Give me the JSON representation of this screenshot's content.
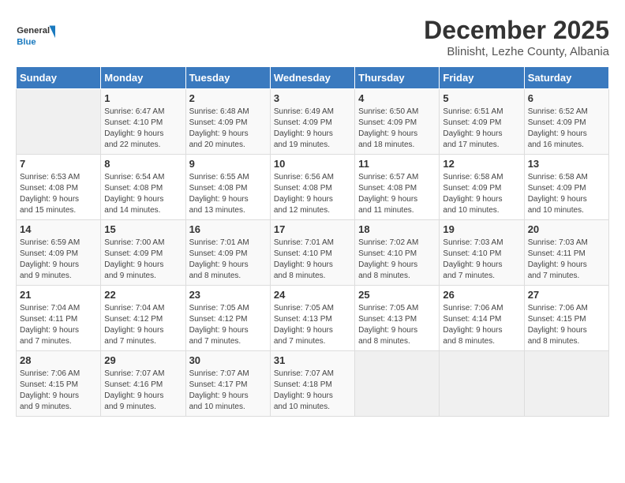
{
  "header": {
    "logo_general": "General",
    "logo_blue": "Blue",
    "month_title": "December 2025",
    "subtitle": "Blinisht, Lezhe County, Albania"
  },
  "weekdays": [
    "Sunday",
    "Monday",
    "Tuesday",
    "Wednesday",
    "Thursday",
    "Friday",
    "Saturday"
  ],
  "weeks": [
    [
      {
        "day": "",
        "info": ""
      },
      {
        "day": "1",
        "info": "Sunrise: 6:47 AM\nSunset: 4:10 PM\nDaylight: 9 hours\nand 22 minutes."
      },
      {
        "day": "2",
        "info": "Sunrise: 6:48 AM\nSunset: 4:09 PM\nDaylight: 9 hours\nand 20 minutes."
      },
      {
        "day": "3",
        "info": "Sunrise: 6:49 AM\nSunset: 4:09 PM\nDaylight: 9 hours\nand 19 minutes."
      },
      {
        "day": "4",
        "info": "Sunrise: 6:50 AM\nSunset: 4:09 PM\nDaylight: 9 hours\nand 18 minutes."
      },
      {
        "day": "5",
        "info": "Sunrise: 6:51 AM\nSunset: 4:09 PM\nDaylight: 9 hours\nand 17 minutes."
      },
      {
        "day": "6",
        "info": "Sunrise: 6:52 AM\nSunset: 4:09 PM\nDaylight: 9 hours\nand 16 minutes."
      }
    ],
    [
      {
        "day": "7",
        "info": "Sunrise: 6:53 AM\nSunset: 4:08 PM\nDaylight: 9 hours\nand 15 minutes."
      },
      {
        "day": "8",
        "info": "Sunrise: 6:54 AM\nSunset: 4:08 PM\nDaylight: 9 hours\nand 14 minutes."
      },
      {
        "day": "9",
        "info": "Sunrise: 6:55 AM\nSunset: 4:08 PM\nDaylight: 9 hours\nand 13 minutes."
      },
      {
        "day": "10",
        "info": "Sunrise: 6:56 AM\nSunset: 4:08 PM\nDaylight: 9 hours\nand 12 minutes."
      },
      {
        "day": "11",
        "info": "Sunrise: 6:57 AM\nSunset: 4:08 PM\nDaylight: 9 hours\nand 11 minutes."
      },
      {
        "day": "12",
        "info": "Sunrise: 6:58 AM\nSunset: 4:09 PM\nDaylight: 9 hours\nand 10 minutes."
      },
      {
        "day": "13",
        "info": "Sunrise: 6:58 AM\nSunset: 4:09 PM\nDaylight: 9 hours\nand 10 minutes."
      }
    ],
    [
      {
        "day": "14",
        "info": "Sunrise: 6:59 AM\nSunset: 4:09 PM\nDaylight: 9 hours\nand 9 minutes."
      },
      {
        "day": "15",
        "info": "Sunrise: 7:00 AM\nSunset: 4:09 PM\nDaylight: 9 hours\nand 9 minutes."
      },
      {
        "day": "16",
        "info": "Sunrise: 7:01 AM\nSunset: 4:09 PM\nDaylight: 9 hours\nand 8 minutes."
      },
      {
        "day": "17",
        "info": "Sunrise: 7:01 AM\nSunset: 4:10 PM\nDaylight: 9 hours\nand 8 minutes."
      },
      {
        "day": "18",
        "info": "Sunrise: 7:02 AM\nSunset: 4:10 PM\nDaylight: 9 hours\nand 8 minutes."
      },
      {
        "day": "19",
        "info": "Sunrise: 7:03 AM\nSunset: 4:10 PM\nDaylight: 9 hours\nand 7 minutes."
      },
      {
        "day": "20",
        "info": "Sunrise: 7:03 AM\nSunset: 4:11 PM\nDaylight: 9 hours\nand 7 minutes."
      }
    ],
    [
      {
        "day": "21",
        "info": "Sunrise: 7:04 AM\nSunset: 4:11 PM\nDaylight: 9 hours\nand 7 minutes."
      },
      {
        "day": "22",
        "info": "Sunrise: 7:04 AM\nSunset: 4:12 PM\nDaylight: 9 hours\nand 7 minutes."
      },
      {
        "day": "23",
        "info": "Sunrise: 7:05 AM\nSunset: 4:12 PM\nDaylight: 9 hours\nand 7 minutes."
      },
      {
        "day": "24",
        "info": "Sunrise: 7:05 AM\nSunset: 4:13 PM\nDaylight: 9 hours\nand 7 minutes."
      },
      {
        "day": "25",
        "info": "Sunrise: 7:05 AM\nSunset: 4:13 PM\nDaylight: 9 hours\nand 8 minutes."
      },
      {
        "day": "26",
        "info": "Sunrise: 7:06 AM\nSunset: 4:14 PM\nDaylight: 9 hours\nand 8 minutes."
      },
      {
        "day": "27",
        "info": "Sunrise: 7:06 AM\nSunset: 4:15 PM\nDaylight: 9 hours\nand 8 minutes."
      }
    ],
    [
      {
        "day": "28",
        "info": "Sunrise: 7:06 AM\nSunset: 4:15 PM\nDaylight: 9 hours\nand 9 minutes."
      },
      {
        "day": "29",
        "info": "Sunrise: 7:07 AM\nSunset: 4:16 PM\nDaylight: 9 hours\nand 9 minutes."
      },
      {
        "day": "30",
        "info": "Sunrise: 7:07 AM\nSunset: 4:17 PM\nDaylight: 9 hours\nand 10 minutes."
      },
      {
        "day": "31",
        "info": "Sunrise: 7:07 AM\nSunset: 4:18 PM\nDaylight: 9 hours\nand 10 minutes."
      },
      {
        "day": "",
        "info": ""
      },
      {
        "day": "",
        "info": ""
      },
      {
        "day": "",
        "info": ""
      }
    ]
  ]
}
